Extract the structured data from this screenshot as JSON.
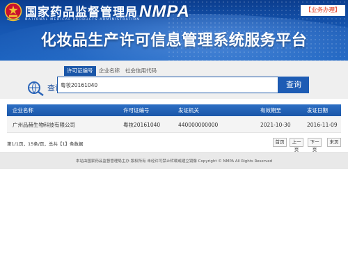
{
  "header": {
    "agency_name": "国家药品监督管理局",
    "agency_name_en": "NATIONAL MEDICAL PRODUCTS ADMINISTRATION",
    "agency_abbr": "NMPA",
    "business_tag": "【业务办理】",
    "system_title": "化妆品生产许可信息管理系统服务平台"
  },
  "search": {
    "label": "查询",
    "tabs": [
      {
        "label": "许可证编号",
        "active": true
      },
      {
        "label": "企业名称",
        "active": false
      },
      {
        "label": "社会信用代码",
        "active": false
      }
    ],
    "input_value": "粤妆20161040",
    "button_label": "查询"
  },
  "table": {
    "columns": [
      "企业名称",
      "许可证编号",
      "发证机关",
      "有效期至",
      "发证日期"
    ],
    "rows": [
      [
        "广州品赫生物科技有限公司",
        "粤妆20161040",
        "440000000000",
        "2021-10-30",
        "2016-11-09"
      ]
    ]
  },
  "pagination": {
    "summary": "第1/1页，15条/页，总共【1】条数据",
    "buttons": [
      "首页",
      "上一页",
      "下一页",
      "末页"
    ]
  },
  "footer": {
    "text": "本站由国家药品监督管理局主办 版权所有 未经许可禁止转载或建立镜像 Copyright © NMPA All Rights Reserved"
  },
  "colors": {
    "header_blue": "#1555b0",
    "accent_blue": "#1a56a8",
    "tag_red": "#e33a1e"
  }
}
